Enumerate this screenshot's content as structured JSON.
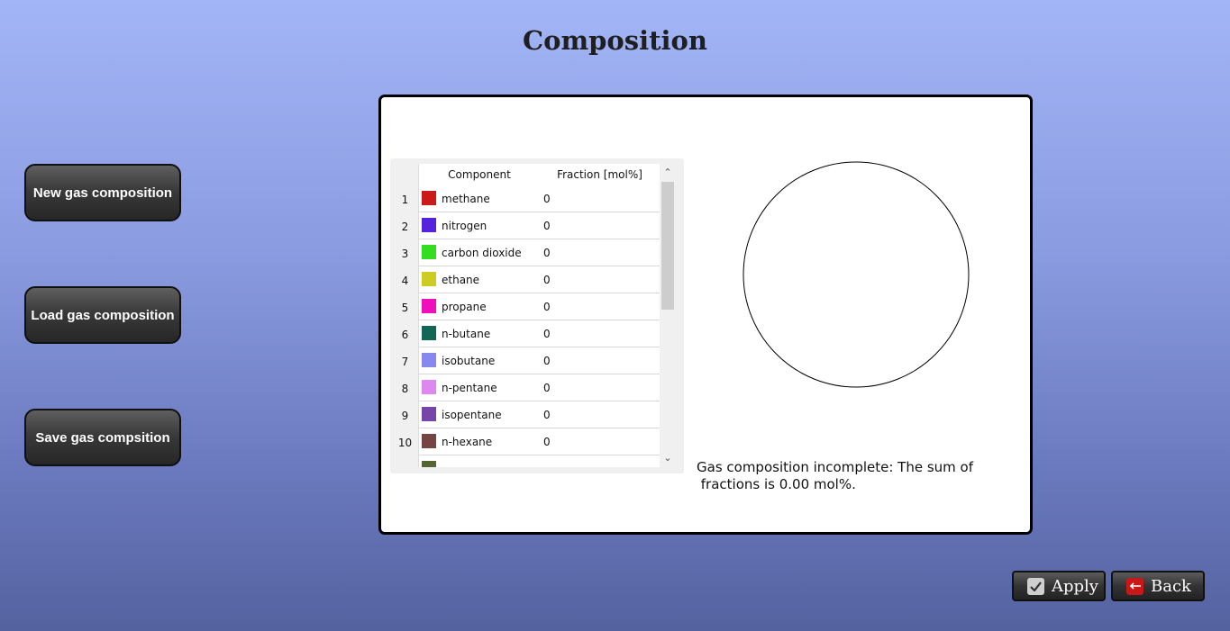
{
  "page": {
    "title": "Composition"
  },
  "sidebar": {
    "buttons": [
      {
        "label": "New gas composition"
      },
      {
        "label": "Load gas composition"
      },
      {
        "label": "Save gas compsition"
      }
    ]
  },
  "table": {
    "headers": {
      "component": "Component",
      "fraction": "Fraction [mol%]"
    },
    "rows": [
      {
        "index": "1",
        "component": "methane",
        "fraction": "0",
        "color": "#cc1a1a"
      },
      {
        "index": "2",
        "component": "nitrogen",
        "fraction": "0",
        "color": "#5522dd"
      },
      {
        "index": "3",
        "component": "carbon dioxide",
        "fraction": "0",
        "color": "#33dd22"
      },
      {
        "index": "4",
        "component": "ethane",
        "fraction": "0",
        "color": "#cccc22"
      },
      {
        "index": "5",
        "component": "propane",
        "fraction": "0",
        "color": "#ee11bb"
      },
      {
        "index": "6",
        "component": "n-butane",
        "fraction": "0",
        "color": "#116655"
      },
      {
        "index": "7",
        "component": "isobutane",
        "fraction": "0",
        "color": "#8888ee"
      },
      {
        "index": "8",
        "component": "n-pentane",
        "fraction": "0",
        "color": "#dd88ee"
      },
      {
        "index": "9",
        "component": "isopentane",
        "fraction": "0",
        "color": "#7744aa"
      },
      {
        "index": "10",
        "component": "n-hexane",
        "fraction": "0",
        "color": "#774444"
      },
      {
        "index": "",
        "component": "",
        "fraction": "",
        "color": "#556633"
      }
    ]
  },
  "status": {
    "message": "Gas composition incomplete: The sum of\n fractions is 0.00 mol%."
  },
  "footer": {
    "apply_label": "Apply",
    "back_label": "Back"
  }
}
